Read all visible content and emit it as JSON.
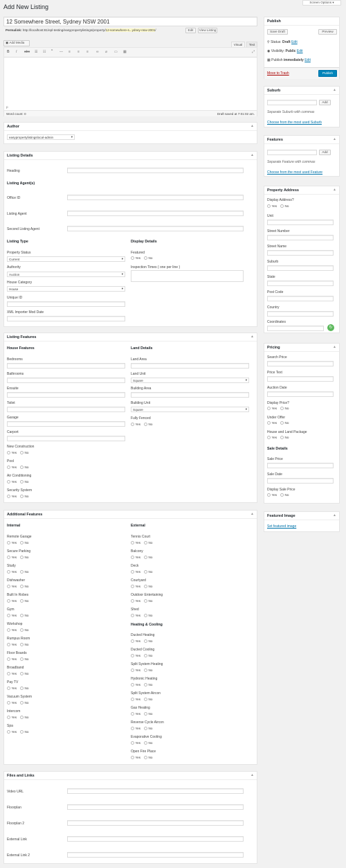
{
  "page_title": "Add New Listing",
  "screen_options": "Screen Options ▾",
  "post_title": "12 Somewhere Street, Sydney NSW 2001",
  "permalink": {
    "label": "Permalink:",
    "base": "http://localhost:81/epl-testing/easypropertylistings/property/",
    "slug": "12-somewhere-s...ydney-nsw-2001",
    "tail": "/",
    "edit": "Edit",
    "view": "View Listing"
  },
  "editor": {
    "add_media": "Add Media",
    "tab_visual": "Visual",
    "tab_text": "Text",
    "path": "p",
    "word_count": "Word count: 0",
    "draft_saved": "Draft saved at 7:01:02 am."
  },
  "author": {
    "title": "Author",
    "value": "easypropertylistingslocal-admin"
  },
  "listing_details": {
    "title": "Listing Details",
    "heading": "Heading",
    "agents_title": "Listing Agent(s)",
    "office_id": "Office ID",
    "listing_agent": "Listing Agent",
    "second_listing_agent": "Second Listing Agent",
    "listing_type": "Listing Type",
    "property_status": "Property Status",
    "property_status_val": "Current",
    "authority": "Authority",
    "authority_val": "Auction",
    "house_category": "House Category",
    "house_category_val": "House",
    "unique_id": "Unique ID",
    "xml_mod_date": "XML Importer Mod Date",
    "display_details": "Display Details",
    "featured": "Featured",
    "inspection_times": "Inspection Times ( one per line )"
  },
  "radio": {
    "yes": "Yes",
    "no": "No"
  },
  "listing_features": {
    "title": "Listing Features",
    "house_features": "House Features",
    "land_details": "Land Details",
    "bedrooms": "Bedrooms",
    "bathrooms": "Bathrooms",
    "ensuite": "Ensuite",
    "toilet": "Toilet",
    "garage": "Garage",
    "carport": "Carport",
    "new_construction": "New Construction",
    "pool": "Pool",
    "air_conditioning": "Air Conditioning",
    "security_system": "Security System",
    "land_area": "Land Area",
    "land_unit": "Land Unit",
    "land_unit_val": "Square",
    "building_area": "Building Area",
    "building_unit": "Building Unit",
    "building_unit_val": "Square",
    "fully_fenced": "Fully Fenced"
  },
  "additional_features": {
    "title": "Additional Features",
    "internal": "Internal",
    "external": "External",
    "heating_cooling": "Heating & Cooling",
    "internal_items": [
      "Remote Garage",
      "Secure Parking",
      "Study",
      "Dishwasher",
      "Built In Robes",
      "Gym",
      "Workshop",
      "Rumpus Room",
      "Floor Boards",
      "Broadband",
      "Pay TV",
      "Vacuum System",
      "Intercom",
      "Spa"
    ],
    "external_items": [
      "Tennis Court",
      "Balcony",
      "Deck",
      "Courtyard",
      "Outdoor Entertaining",
      "Shed"
    ],
    "hc_items": [
      "Ducted Heating",
      "Ducted Cooling",
      "Split System Heating",
      "Hydronic Heating",
      "Split System Aircon",
      "Gas Heating",
      "Reverse Cycle Aircon",
      "Evaporative Cooling",
      "Open Fire Place"
    ]
  },
  "files_links": {
    "title": "Files and Links",
    "video_url": "Video URL",
    "floorplan": "Floorplan",
    "floorplan2": "Floorplan 2",
    "external_link": "External Link",
    "external_link2": "External Link 2"
  },
  "publish": {
    "title": "Publish",
    "save_draft": "Save Draft",
    "preview": "Preview",
    "status_label": "Status:",
    "status_val": "Draft",
    "visibility_label": "Visibility:",
    "visibility_val": "Public",
    "publish_label": "Publish",
    "publish_val": "immediately",
    "edit": "Edit",
    "trash": "Move to Trash",
    "publish_btn": "Publish"
  },
  "suburb": {
    "title": "Suburb",
    "add": "Add",
    "hint": "Separate Suburb with commas",
    "choose": "Choose from the most used Suburb"
  },
  "features": {
    "title": "Features",
    "add": "Add",
    "hint": "Separate Feature with commas",
    "choose": "Choose from the most used Feature"
  },
  "property_address": {
    "title": "Property Address",
    "display_address": "Display Address?",
    "unit": "Unit",
    "street_number": "Street Number",
    "street_name": "Street Name",
    "suburb": "Suburb",
    "state": "State",
    "post_code": "Post Code",
    "country": "Country",
    "coordinates": "Coordinates"
  },
  "pricing": {
    "title": "Pricing",
    "search_price": "Search Price",
    "price_text": "Price Text",
    "auction_date": "Auction Date",
    "display_price": "Display Price?",
    "under_offer": "Under Offer",
    "house_land_package": "House and Land Package",
    "sale_details": "Sale Details",
    "sale_price": "Sale Price",
    "sale_date": "Sale Date",
    "display_sale_price": "Display Sale Price"
  },
  "featured_image": {
    "title": "Featured Image",
    "set": "Set featured image"
  }
}
